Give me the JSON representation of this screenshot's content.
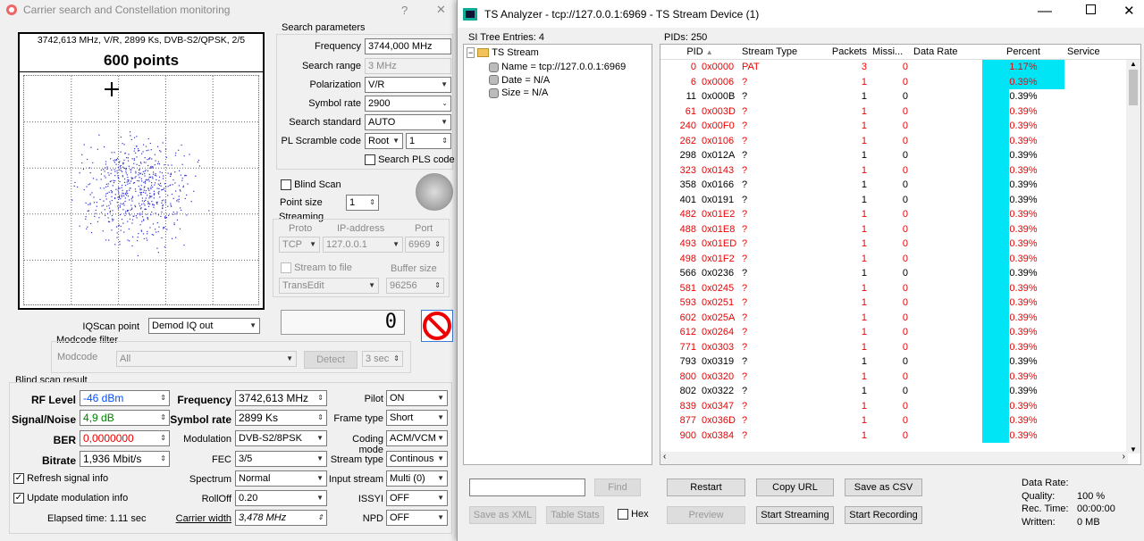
{
  "win1": {
    "title": "Carrier search and Constellation monitoring",
    "help": "?",
    "close": "✕",
    "const_info": "3742,613 MHz, V/R, 2899 Ks, DVB-S2/QPSK, 2/5",
    "points": "600 points",
    "search": {
      "title": "Search parameters",
      "frequency_label": "Frequency",
      "frequency": "3744,000 MHz",
      "range_label": "Search range",
      "range": "3 MHz",
      "pol_label": "Polarization",
      "pol": "V/R",
      "sr_label": "Symbol rate",
      "sr": "2900",
      "std_label": "Search standard",
      "std": "AUTO",
      "pls_label": "PL Scramble code",
      "pls_mode": "Root",
      "pls_val": "1",
      "pls_search": "Search PLS code"
    },
    "blind_scan": "Blind Scan",
    "point_size_label": "Point size",
    "point_size": "1",
    "streaming": {
      "title": "Streaming",
      "proto_label": "Proto",
      "ip_label": "IP-address",
      "port_label": "Port",
      "proto": "TCP",
      "ip": "127.0.0.1",
      "port": "6969",
      "to_file": "Stream to file",
      "buffer_label": "Buffer size",
      "app": "TransEdit",
      "buffer": "96256"
    },
    "counter": "0",
    "iq_label": "IQScan point",
    "iq": "Demod IQ out",
    "modcode": {
      "title": "Modcode filter",
      "label": "Modcode",
      "value": "All",
      "detect": "Detect",
      "sec": "3 sec"
    },
    "result": {
      "title": "Blind scan result",
      "rf_label": "RF Level",
      "rf": "-46 dBm",
      "sn_label": "Signal/Noise",
      "sn": "4,9 dB",
      "ber_label": "BER",
      "ber": "0,0000000",
      "bitrate_label": "Bitrate",
      "bitrate": "1,936 Mbit/s",
      "freq_label": "Frequency",
      "freq": "3742,613 MHz",
      "sr_label": "Symbol rate",
      "sr": "2899 Ks",
      "mod_label": "Modulation",
      "mod": "DVB-S2/8PSK",
      "fec_label": "FEC",
      "fec": "3/5",
      "spec_label": "Spectrum",
      "spec": "Normal",
      "roll_label": "RollOff",
      "roll": "0.20",
      "cw_label": "Carrier width",
      "cw": "3,478 MHz",
      "pilot_label": "Pilot",
      "pilot": "ON",
      "ft_label": "Frame type",
      "ft": "Short",
      "cm_label": "Coding mode",
      "cm": "ACM/VCM",
      "st_label": "Stream type",
      "st": "Continous",
      "is_label": "Input stream",
      "is": "Multi (0)",
      "issyi_label": "ISSYI",
      "issyi": "OFF",
      "npd_label": "NPD",
      "npd": "OFF",
      "refresh": "Refresh signal info",
      "update": "Update modulation info",
      "elapsed": "Elapsed time: 1.11 sec"
    }
  },
  "win2": {
    "title": "TS Analyzer - tcp://127.0.0.1:6969 - TS Stream Device (1)",
    "si_label": "SI Tree Entries: 4",
    "pids_label": "PIDs: 250",
    "tree": {
      "root": "TS Stream",
      "items": [
        "Name = tcp://127.0.0.1:6969",
        "Date = N/A",
        "Size = N/A"
      ]
    },
    "cols": [
      "PID",
      "Stream Type",
      "Packets",
      "Missi...",
      "Data Rate",
      "Percent",
      "Service"
    ],
    "rows": [
      {
        "pid": "0",
        "hex": "0x0000",
        "type": "PAT",
        "packets": "3",
        "miss": "0",
        "pct": "1.17%",
        "red": true,
        "fill": 1.0
      },
      {
        "pid": "6",
        "hex": "0x0006",
        "type": "?",
        "packets": "1",
        "miss": "0",
        "pct": "0.39%",
        "red": true,
        "fill": 1.0
      },
      {
        "pid": "11",
        "hex": "0x000B",
        "type": "?",
        "packets": "1",
        "miss": "0",
        "pct": "0.39%",
        "red": false,
        "fill": 0.33
      },
      {
        "pid": "61",
        "hex": "0x003D",
        "type": "?",
        "packets": "1",
        "miss": "0",
        "pct": "0.39%",
        "red": true,
        "fill": 0.33
      },
      {
        "pid": "240",
        "hex": "0x00F0",
        "type": "?",
        "packets": "1",
        "miss": "0",
        "pct": "0.39%",
        "red": true,
        "fill": 0.33
      },
      {
        "pid": "262",
        "hex": "0x0106",
        "type": "?",
        "packets": "1",
        "miss": "0",
        "pct": "0.39%",
        "red": true,
        "fill": 0.33
      },
      {
        "pid": "298",
        "hex": "0x012A",
        "type": "?",
        "packets": "1",
        "miss": "0",
        "pct": "0.39%",
        "red": false,
        "fill": 0.33
      },
      {
        "pid": "323",
        "hex": "0x0143",
        "type": "?",
        "packets": "1",
        "miss": "0",
        "pct": "0.39%",
        "red": true,
        "fill": 0.33
      },
      {
        "pid": "358",
        "hex": "0x0166",
        "type": "?",
        "packets": "1",
        "miss": "0",
        "pct": "0.39%",
        "red": false,
        "fill": 0.33
      },
      {
        "pid": "401",
        "hex": "0x0191",
        "type": "?",
        "packets": "1",
        "miss": "0",
        "pct": "0.39%",
        "red": false,
        "fill": 0.33
      },
      {
        "pid": "482",
        "hex": "0x01E2",
        "type": "?",
        "packets": "1",
        "miss": "0",
        "pct": "0.39%",
        "red": true,
        "fill": 0.33
      },
      {
        "pid": "488",
        "hex": "0x01E8",
        "type": "?",
        "packets": "1",
        "miss": "0",
        "pct": "0.39%",
        "red": true,
        "fill": 0.33
      },
      {
        "pid": "493",
        "hex": "0x01ED",
        "type": "?",
        "packets": "1",
        "miss": "0",
        "pct": "0.39%",
        "red": true,
        "fill": 0.33
      },
      {
        "pid": "498",
        "hex": "0x01F2",
        "type": "?",
        "packets": "1",
        "miss": "0",
        "pct": "0.39%",
        "red": true,
        "fill": 0.33
      },
      {
        "pid": "566",
        "hex": "0x0236",
        "type": "?",
        "packets": "1",
        "miss": "0",
        "pct": "0.39%",
        "red": false,
        "fill": 0.33
      },
      {
        "pid": "581",
        "hex": "0x0245",
        "type": "?",
        "packets": "1",
        "miss": "0",
        "pct": "0.39%",
        "red": true,
        "fill": 0.33
      },
      {
        "pid": "593",
        "hex": "0x0251",
        "type": "?",
        "packets": "1",
        "miss": "0",
        "pct": "0.39%",
        "red": true,
        "fill": 0.33
      },
      {
        "pid": "602",
        "hex": "0x025A",
        "type": "?",
        "packets": "1",
        "miss": "0",
        "pct": "0.39%",
        "red": true,
        "fill": 0.33
      },
      {
        "pid": "612",
        "hex": "0x0264",
        "type": "?",
        "packets": "1",
        "miss": "0",
        "pct": "0.39%",
        "red": true,
        "fill": 0.33
      },
      {
        "pid": "771",
        "hex": "0x0303",
        "type": "?",
        "packets": "1",
        "miss": "0",
        "pct": "0.39%",
        "red": true,
        "fill": 0.33
      },
      {
        "pid": "793",
        "hex": "0x0319",
        "type": "?",
        "packets": "1",
        "miss": "0",
        "pct": "0.39%",
        "red": false,
        "fill": 0.33
      },
      {
        "pid": "800",
        "hex": "0x0320",
        "type": "?",
        "packets": "1",
        "miss": "0",
        "pct": "0.39%",
        "red": true,
        "fill": 0.33
      },
      {
        "pid": "802",
        "hex": "0x0322",
        "type": "?",
        "packets": "1",
        "miss": "0",
        "pct": "0.39%",
        "red": false,
        "fill": 0.33
      },
      {
        "pid": "839",
        "hex": "0x0347",
        "type": "?",
        "packets": "1",
        "miss": "0",
        "pct": "0.39%",
        "red": true,
        "fill": 0.33
      },
      {
        "pid": "877",
        "hex": "0x036D",
        "type": "?",
        "packets": "1",
        "miss": "0",
        "pct": "0.39%",
        "red": true,
        "fill": 0.33
      },
      {
        "pid": "900",
        "hex": "0x0384",
        "type": "?",
        "packets": "1",
        "miss": "0",
        "pct": "0.39%",
        "red": true,
        "fill": 0.33
      }
    ],
    "find": "Find",
    "save_xml": "Save as XML",
    "table_stats": "Table Stats",
    "hex": "Hex",
    "restart": "Restart",
    "copy_url": "Copy URL",
    "save_csv": "Save as CSV",
    "preview": "Preview",
    "start_streaming": "Start Streaming",
    "start_recording": "Start Recording",
    "stats": {
      "dr_label": "Data Rate:",
      "q_label": "Quality:",
      "q": "100 %",
      "rt_label": "Rec. Time:",
      "rt": "00:00:00",
      "w_label": "Written:",
      "w": "0 MB"
    },
    "colors": {
      "red": "#e00000",
      "cyan": "#00e5f5",
      "blue": "#0050ff",
      "green": "#008000"
    }
  }
}
